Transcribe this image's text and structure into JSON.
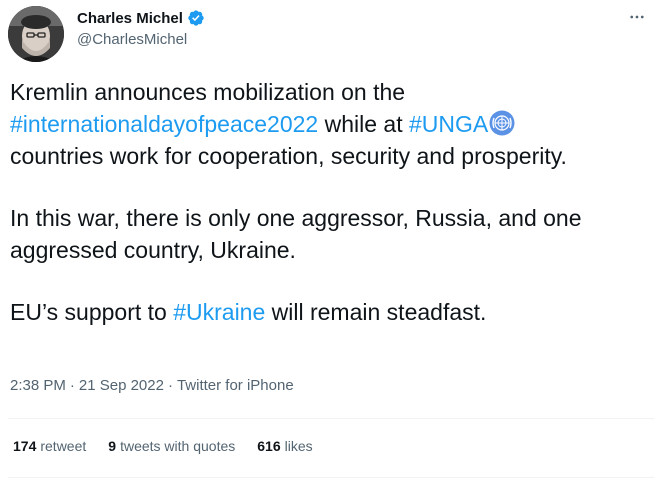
{
  "author": {
    "display_name": "Charles Michel",
    "handle": "@CharlesMichel",
    "verified_color": "#1d9bf0"
  },
  "tweet": {
    "p1_a": "Kremlin announces mobilization on the",
    "p1_tag1": "#internationaldayofpeace2022",
    "p1_b": " while at ",
    "p1_tag2": "#UNGA",
    "p1_c": "countries work for cooperation, security and prosperity.",
    "p2": "In this war, there is only one aggressor, Russia, and one aggressed country, Ukraine.",
    "p3_a": "EU’s support to ",
    "p3_tag": "#Ukraine",
    "p3_b": " will remain steadfast."
  },
  "meta": {
    "time": "2:38 PM",
    "sep1": "·",
    "date": "21 Sep 2022",
    "sep2": "·",
    "source": "Twitter for iPhone"
  },
  "stats": {
    "retweets_count": "174",
    "retweets_label": "retweet",
    "quotes_count": "9",
    "quotes_label": "tweets with quotes",
    "likes_count": "616",
    "likes_label": "likes"
  },
  "colors": {
    "link": "#1d9bf0",
    "secondary_text": "#536471",
    "primary_text": "#0f1419"
  }
}
